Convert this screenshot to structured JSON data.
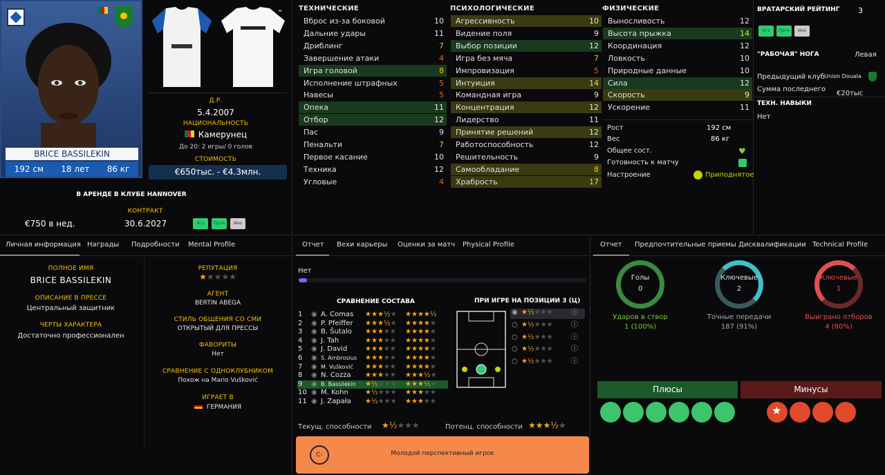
{
  "player": {
    "name_card": "BRICE BASSILEKIN",
    "height": "192 см",
    "age": "18 лет",
    "weight": "86 кг"
  },
  "bio": {
    "dob_label": "Д.Р.",
    "dob": "5.4.2007",
    "nat_label": "НАЦИОНАЛЬНОСТЬ",
    "nationality": "Камерунец",
    "u20": "До 20: 2 игры/ 0 голов",
    "value_label": "СТОИМОСТЬ",
    "value": "€650тыс. - €4.3млн.",
    "loan": "В АРЕНДЕ В КЛУБЕ HANNOVER",
    "contract_label": "КОНТРАКТ",
    "wage": "€750 в нед.",
    "contract_end": "30.6.2027",
    "roles": [
      "Агз",
      "Прсм",
      "Ино"
    ]
  },
  "attrs": {
    "tech_title": "ТЕХНИЧЕСКИЕ",
    "mental_title": "ПСИХОЛОГИЧЕСКИЕ",
    "phys_title": "ФИЗИЧЕСКИЕ",
    "technical": [
      {
        "n": "Вброс из-за боковой",
        "v": "10"
      },
      {
        "n": "Дальние удары",
        "v": "11"
      },
      {
        "n": "Дриблинг",
        "v": "7"
      },
      {
        "n": "Завершение атаки",
        "v": "4"
      },
      {
        "n": "Игра головой",
        "v": "8"
      },
      {
        "n": "Исполнение штрафных",
        "v": "5"
      },
      {
        "n": "Навесы",
        "v": "5"
      },
      {
        "n": "Опека",
        "v": "11"
      },
      {
        "n": "Отбор",
        "v": "12"
      },
      {
        "n": "Пас",
        "v": "9"
      },
      {
        "n": "Пенальти",
        "v": "7"
      },
      {
        "n": "Первое касание",
        "v": "10"
      },
      {
        "n": "Техника",
        "v": "12"
      },
      {
        "n": "Угловые",
        "v": "4"
      }
    ],
    "mental": [
      {
        "n": "Агрессивность",
        "v": "10"
      },
      {
        "n": "Видение поля",
        "v": "9"
      },
      {
        "n": "Выбор позиции",
        "v": "12"
      },
      {
        "n": "Игра без мяча",
        "v": "7"
      },
      {
        "n": "Импровизация",
        "v": "5"
      },
      {
        "n": "Интуиция",
        "v": "14"
      },
      {
        "n": "Командная игра",
        "v": "9"
      },
      {
        "n": "Концентрация",
        "v": "12"
      },
      {
        "n": "Лидерство",
        "v": "11"
      },
      {
        "n": "Принятие решений",
        "v": "12"
      },
      {
        "n": "Работоспособность",
        "v": "12"
      },
      {
        "n": "Решительность",
        "v": "9"
      },
      {
        "n": "Самообладание",
        "v": "8"
      },
      {
        "n": "Храбрость",
        "v": "17"
      }
    ],
    "physical": [
      {
        "n": "Выносливость",
        "v": "12"
      },
      {
        "n": "Высота прыжка",
        "v": "14"
      },
      {
        "n": "Координация",
        "v": "12"
      },
      {
        "n": "Ловкость",
        "v": "10"
      },
      {
        "n": "Природные данные",
        "v": "10"
      },
      {
        "n": "Сила",
        "v": "12"
      },
      {
        "n": "Скорость",
        "v": "9"
      },
      {
        "n": "Ускорение",
        "v": "11"
      }
    ],
    "height_l": "Рост",
    "height_v": "192 см",
    "weight_l": "Вес",
    "weight_v": "86 кг",
    "cond_l": "Общее сост.",
    "fit_l": "Готовность к матчу",
    "morale_l": "Настроение",
    "morale_v": "Приподнятое"
  },
  "right": {
    "gk_label": "ВРАТАРСКИЙ РЕЙТИНГ",
    "gk_value": "3",
    "roles": [
      "Агз",
      "Прсм",
      "Ино"
    ],
    "foot_label": "\"РАБОЧАЯ\" НОГА",
    "foot_value": "Левая",
    "prev_label": "Предыдущий клуб",
    "prev_value": "Union Douala",
    "fee_label": "Сумма последнего",
    "fee_value": "€20тыс",
    "skills_label": "ТЕХН. НАВЫКИ",
    "skills_value": "Нет"
  },
  "left_tabs": [
    "Личная информация",
    "Награды",
    "Подробности",
    "Mental Profile"
  ],
  "personal": {
    "full_label": "ПОЛНОЕ ИМЯ",
    "full": "BRICE BASSILEKIN",
    "press_label": "ОПИСАНИЕ В ПРЕССЕ",
    "press": "Центральный защитник",
    "traits_label": "ЧЕРТЫ ХАРАКТЕРА",
    "traits": "Достаточно профессионален",
    "rep_label": "РЕПУТАЦИЯ",
    "agent_label": "АГЕНТ",
    "agent": "BERTIN ABEGA",
    "media_label": "СТИЛЬ ОБЩЕНИЯ СО СМИ",
    "media": "ОТКРЫТЫЙ ДЛЯ ПРЕССЫ",
    "fav_label": "ФАВОРИТЫ",
    "fav": "Нет",
    "cmp_label": "СРАВНЕНИЕ С ОДНОКЛУБНИКОМ",
    "cmp": "Похож на Mario Vušković",
    "plays_label": "ИГРАЕТ В",
    "plays": "ГЕРМАНИЯ"
  },
  "mid_tabs": [
    "Отчет",
    "Вехи карьеры",
    "Оценки за матч",
    "Physical Profile"
  ],
  "report": {
    "none": "Нет",
    "squad_title": "СРАВНЕНИЕ СОСТАВА",
    "pos_title": "ПРИ ИГРЕ НА ПОЗИЦИИ 3 (Ц)",
    "cur_label": "Текущ. способности",
    "pot_label": "Потенц. способности",
    "grade": "C-",
    "summary": "Молодой перспективный игрок",
    "squad": [
      {
        "n": "1",
        "name": "A. Comas",
        "a": 3.5,
        "b": 4.5
      },
      {
        "n": "2",
        "name": "P. Pfeiffer",
        "a": 3.5,
        "b": 4
      },
      {
        "n": "3",
        "name": "B. Šutalo",
        "a": 3,
        "b": 4
      },
      {
        "n": "4",
        "name": "J. Tah",
        "a": 3,
        "b": 4
      },
      {
        "n": "5",
        "name": "J. David",
        "a": 3,
        "b": 4
      },
      {
        "n": "6",
        "name": "S. Ambrosius",
        "a": 3,
        "b": 4
      },
      {
        "n": "7",
        "name": "M. Vušković",
        "a": 3,
        "b": 4
      },
      {
        "n": "8",
        "name": "N. Cozza",
        "a": 3,
        "b": 3.5
      },
      {
        "n": "9",
        "name": "B. Bassilekin",
        "a": 1.5,
        "b": 3.5
      },
      {
        "n": "10",
        "name": "M. Kohn",
        "a": 1.5,
        "b": 3
      },
      {
        "n": "11",
        "name": "J. Zapała",
        "a": 1.5,
        "b": 3
      }
    ]
  },
  "right_tabs": [
    "Отчет",
    "Предпочтительные приемы",
    "Дисквалификации",
    "Technical Profile"
  ],
  "stats": {
    "goals_l": "Голы",
    "goals_v": "0",
    "shots_l": "Ударов в створ",
    "shots_v": "1 (100%)",
    "key_l": "Ключевые",
    "key_v": "2",
    "pass_l": "Точные передачи",
    "pass_v": "187 (91%)",
    "kt_l": "Ключевые",
    "kt_v": "1",
    "tk_l": "Выиграно отборов",
    "tk_v": "4 (80%)",
    "pros": "Плюсы",
    "cons": "Минусы"
  },
  "colors": {
    "accent": "#f4c400",
    "green": "#1b7a2e",
    "red": "#8b1a1a"
  }
}
